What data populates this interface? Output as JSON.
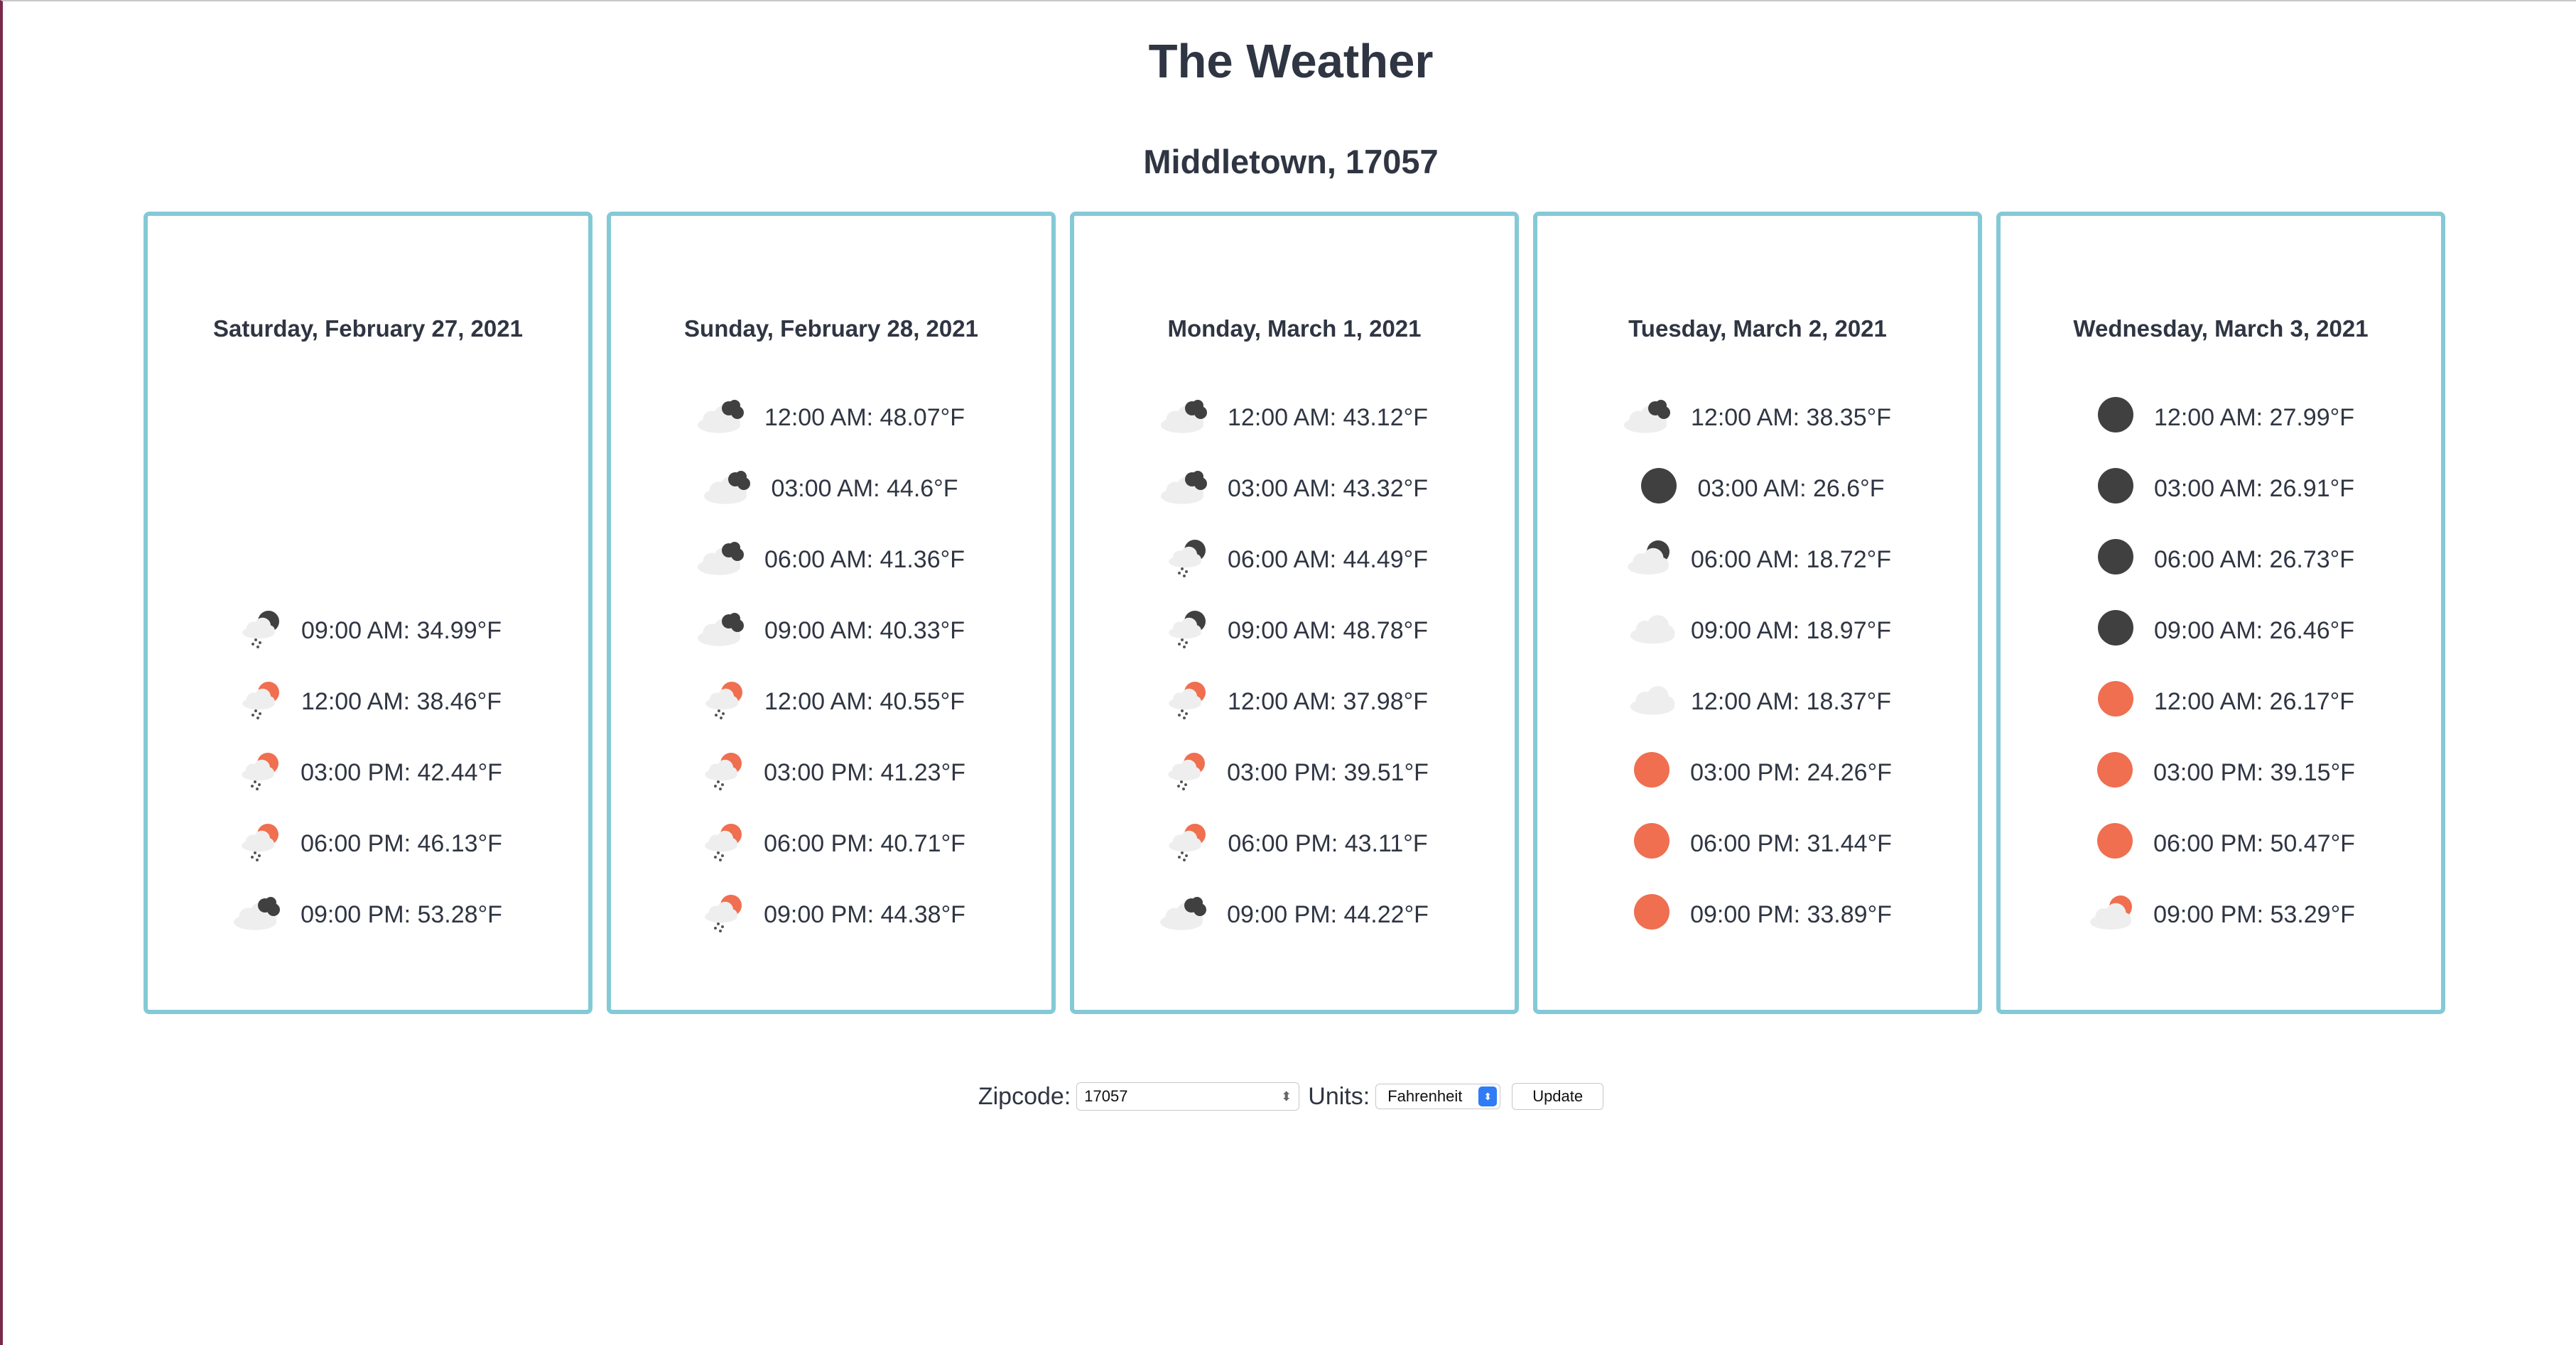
{
  "header": {
    "title": "The Weather",
    "location": "Middletown, 17057"
  },
  "colors": {
    "card_border": "#84c9d6",
    "sun": "#ef6f50",
    "moon": "#404040",
    "cloud": "#eeeeee",
    "text": "#2f3542"
  },
  "forecast": [
    {
      "date": "Saturday, February 27, 2021",
      "entries": [
        {
          "slot": 3,
          "icon": "night-rain",
          "text": "09:00 AM: 34.99°F"
        },
        {
          "slot": 4,
          "icon": "day-rain",
          "text": "12:00 AM: 38.46°F"
        },
        {
          "slot": 5,
          "icon": "day-rain",
          "text": "03:00 PM: 42.44°F"
        },
        {
          "slot": 6,
          "icon": "day-rain",
          "text": "06:00 PM: 46.13°F"
        },
        {
          "slot": 7,
          "icon": "night-cloudy",
          "text": "09:00 PM: 53.28°F"
        }
      ]
    },
    {
      "date": "Sunday, February 28, 2021",
      "entries": [
        {
          "slot": 0,
          "icon": "night-cloudy",
          "text": "12:00 AM: 48.07°F"
        },
        {
          "slot": 1,
          "icon": "night-cloudy",
          "text": "03:00 AM: 44.6°F"
        },
        {
          "slot": 2,
          "icon": "night-cloudy",
          "text": "06:00 AM: 41.36°F"
        },
        {
          "slot": 3,
          "icon": "night-cloudy",
          "text": "09:00 AM: 40.33°F"
        },
        {
          "slot": 4,
          "icon": "day-rain",
          "text": "12:00 AM: 40.55°F"
        },
        {
          "slot": 5,
          "icon": "day-rain",
          "text": "03:00 PM: 41.23°F"
        },
        {
          "slot": 6,
          "icon": "day-rain",
          "text": "06:00 PM: 40.71°F"
        },
        {
          "slot": 7,
          "icon": "day-rain",
          "text": "09:00 PM: 44.38°F"
        }
      ]
    },
    {
      "date": "Monday, March 1, 2021",
      "entries": [
        {
          "slot": 0,
          "icon": "night-cloudy",
          "text": "12:00 AM: 43.12°F"
        },
        {
          "slot": 1,
          "icon": "night-cloudy",
          "text": "03:00 AM: 43.32°F"
        },
        {
          "slot": 2,
          "icon": "night-rain",
          "text": "06:00 AM: 44.49°F"
        },
        {
          "slot": 3,
          "icon": "night-rain",
          "text": "09:00 AM: 48.78°F"
        },
        {
          "slot": 4,
          "icon": "day-rain",
          "text": "12:00 AM: 37.98°F"
        },
        {
          "slot": 5,
          "icon": "day-rain",
          "text": "03:00 PM: 39.51°F"
        },
        {
          "slot": 6,
          "icon": "day-rain",
          "text": "06:00 PM: 43.11°F"
        },
        {
          "slot": 7,
          "icon": "night-cloudy",
          "text": "09:00 PM: 44.22°F"
        }
      ]
    },
    {
      "date": "Tuesday, March 2, 2021",
      "entries": [
        {
          "slot": 0,
          "icon": "night-cloudy",
          "text": "12:00 AM: 38.35°F"
        },
        {
          "slot": 1,
          "icon": "moon",
          "text": "03:00 AM: 26.6°F"
        },
        {
          "slot": 2,
          "icon": "night-partly",
          "text": "06:00 AM: 18.72°F"
        },
        {
          "slot": 3,
          "icon": "cloud",
          "text": "09:00 AM: 18.97°F"
        },
        {
          "slot": 4,
          "icon": "cloud",
          "text": "12:00 AM: 18.37°F"
        },
        {
          "slot": 5,
          "icon": "sun",
          "text": "03:00 PM: 24.26°F"
        },
        {
          "slot": 6,
          "icon": "sun",
          "text": "06:00 PM: 31.44°F"
        },
        {
          "slot": 7,
          "icon": "sun",
          "text": "09:00 PM: 33.89°F"
        }
      ]
    },
    {
      "date": "Wednesday, March 3, 2021",
      "entries": [
        {
          "slot": 0,
          "icon": "moon",
          "text": "12:00 AM: 27.99°F"
        },
        {
          "slot": 1,
          "icon": "moon",
          "text": "03:00 AM: 26.91°F"
        },
        {
          "slot": 2,
          "icon": "moon",
          "text": "06:00 AM: 26.73°F"
        },
        {
          "slot": 3,
          "icon": "moon",
          "text": "09:00 AM: 26.46°F"
        },
        {
          "slot": 4,
          "icon": "sun",
          "text": "12:00 AM: 26.17°F"
        },
        {
          "slot": 5,
          "icon": "sun",
          "text": "03:00 PM: 39.15°F"
        },
        {
          "slot": 6,
          "icon": "sun",
          "text": "06:00 PM: 50.47°F"
        },
        {
          "slot": 7,
          "icon": "day-partly",
          "text": "09:00 PM: 53.29°F"
        }
      ]
    }
  ],
  "controls": {
    "zipcode_label": "Zipcode:",
    "zipcode_value": "17057",
    "units_label": "Units:",
    "units_value": "Fahrenheit",
    "update_label": "Update"
  }
}
